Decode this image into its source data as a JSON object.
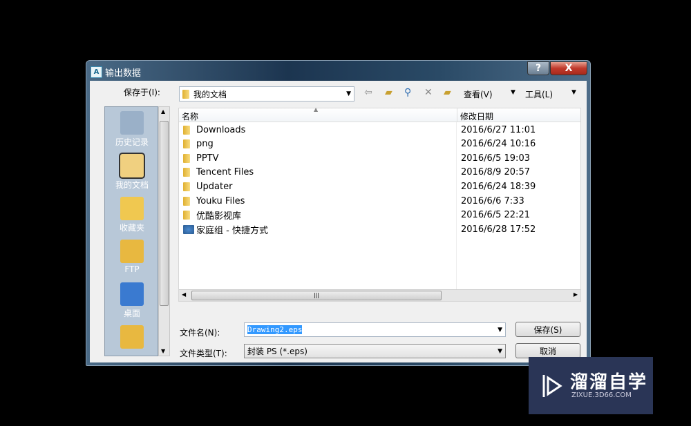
{
  "dialog": {
    "title": "输出数据",
    "help": "?",
    "close": "X"
  },
  "toolbar": {
    "save_in_label": "保存于(I):",
    "location": "我的文档",
    "view_label": "查看(V)",
    "tools_label": "工具(L)",
    "icons": [
      "back-icon",
      "up-folder-icon",
      "search-web-icon",
      "delete-icon",
      "new-folder-icon"
    ]
  },
  "sidebar": {
    "items": [
      {
        "label": "历史记录",
        "icon": "history-icon"
      },
      {
        "label": "我的文档",
        "icon": "my-documents-icon"
      },
      {
        "label": "收藏夹",
        "icon": "favorites-icon"
      },
      {
        "label": "FTP",
        "icon": "ftp-icon"
      },
      {
        "label": "桌面",
        "icon": "desktop-icon"
      },
      {
        "label": "",
        "icon": "buzzsaw-icon"
      }
    ]
  },
  "list": {
    "columns": [
      "名称",
      "修改日期"
    ],
    "rows": [
      {
        "name": "Downloads",
        "date": "2016/6/27 11:01",
        "icon": "folder"
      },
      {
        "name": "png",
        "date": "2016/6/24 10:16",
        "icon": "folder"
      },
      {
        "name": "PPTV",
        "date": "2016/6/5 19:03",
        "icon": "folder"
      },
      {
        "name": "Tencent Files",
        "date": "2016/8/9 20:57",
        "icon": "folder"
      },
      {
        "name": "Updater",
        "date": "2016/6/24 18:39",
        "icon": "folder"
      },
      {
        "name": "Youku Files",
        "date": "2016/6/6 7:33",
        "icon": "folder"
      },
      {
        "name": "优酷影视库",
        "date": "2016/6/5 22:21",
        "icon": "folder"
      },
      {
        "name": "家庭组 - 快捷方式",
        "date": "2016/6/28 17:52",
        "icon": "homegroup-shortcut"
      }
    ]
  },
  "filename": {
    "label": "文件名(N):",
    "value": "Drawing2.eps"
  },
  "filetype": {
    "label": "文件类型(T):",
    "value": "封装 PS (*.eps)"
  },
  "buttons": {
    "save": "保存(S)",
    "cancel": "取消"
  },
  "watermark": {
    "brand": "溜溜自学",
    "url": "ZIXUE.3D66.COM"
  }
}
